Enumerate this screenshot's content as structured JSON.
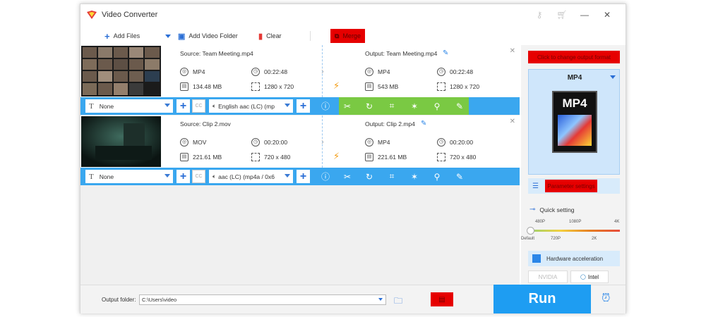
{
  "app": {
    "title": "Video Converter",
    "accent": "#1e9df2",
    "alert_red": "#e60000"
  },
  "titlebar": {
    "icons": [
      "key-icon",
      "cart-icon",
      "minimize-icon",
      "close-icon"
    ]
  },
  "toolbar": {
    "add_files": "Add Files",
    "add_video_folder": "Add Video Folder",
    "clear": "Clear",
    "merge": "Merge"
  },
  "items": [
    {
      "source": "Source: Team Meeting.mp4",
      "output": "Output: Team Meeting.mp4",
      "src": {
        "format": "MP4",
        "duration": "00:22:48",
        "size": "134.48 MB",
        "resolution": "1280 x 720"
      },
      "out": {
        "format": "MP4",
        "duration": "00:22:48",
        "size": "543 MB",
        "resolution": "1280 x 720"
      },
      "subtitle": "None",
      "audio": "English aac (LC) (mp",
      "thumb_style": "meeting"
    },
    {
      "source": "Source: Clip 2.mov",
      "output": "Output: Clip 2.mp4",
      "src": {
        "format": "MOV",
        "duration": "00:20:00",
        "size": "221.61 MB",
        "resolution": "720 x 480"
      },
      "out": {
        "format": "MP4",
        "duration": "00:20:00",
        "size": "221.61 MB",
        "resolution": "720 x 480"
      },
      "subtitle": "None",
      "audio": "aac (LC) (mp4a / 0x6",
      "thumb_style": "dark"
    }
  ],
  "right_panel": {
    "change_format": "Click to change output format",
    "format": "MP4",
    "format_icon_text": "MP4",
    "parameter_settings": "Parameter settings",
    "quick_setting": "Quick setting",
    "quality_top": [
      "480P",
      "1080P",
      "4K"
    ],
    "quality_bottom": [
      "Default",
      "720P",
      "2K"
    ],
    "quality_level": 0,
    "hardware_acceleration": "Hardware acceleration",
    "gpu_nvidia": "NVIDIA",
    "gpu_intel": "Intel"
  },
  "bottom": {
    "output_folder_label": "Output folder:",
    "output_folder_value": "C:\\Users\\video",
    "run": "Run"
  }
}
